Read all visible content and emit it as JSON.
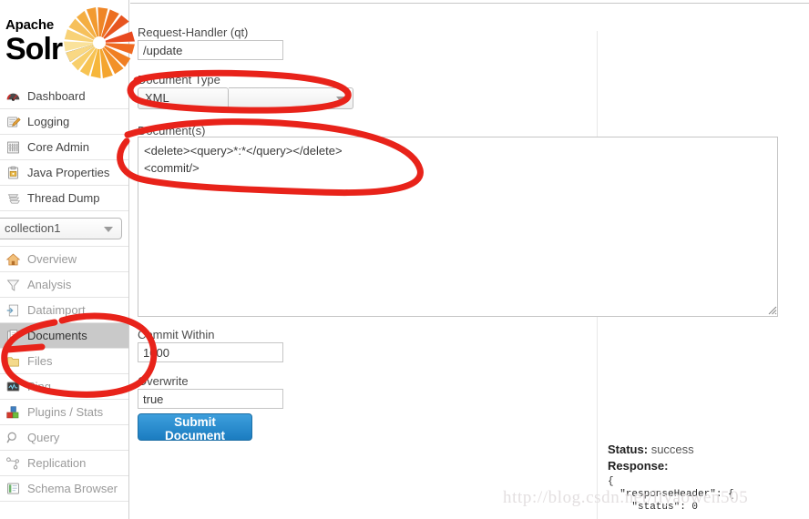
{
  "branding": {
    "apache": "Apache",
    "solr": "Solr",
    "logo_icon": "solr-sunburst-logo",
    "sun_colors": [
      "#f7a823",
      "#ef7e23",
      "#e0491f",
      "#f6d365"
    ]
  },
  "sidebar": {
    "global_items": [
      {
        "label": "Dashboard",
        "icon": "dashboard-gauge-icon",
        "state": "normal"
      },
      {
        "label": "Logging",
        "icon": "logging-icon",
        "state": "normal"
      },
      {
        "label": "Core Admin",
        "icon": "core-admin-icon",
        "state": "normal"
      },
      {
        "label": "Java Properties",
        "icon": "java-properties-icon",
        "state": "normal"
      },
      {
        "label": "Thread Dump",
        "icon": "thread-dump-icon",
        "state": "normal"
      }
    ],
    "core_selector": {
      "value": "collection1",
      "icon": "chevron-down-icon"
    },
    "core_items": [
      {
        "label": "Overview",
        "icon": "home-icon",
        "state": "dim"
      },
      {
        "label": "Analysis",
        "icon": "funnel-icon",
        "state": "dim"
      },
      {
        "label": "Dataimport",
        "icon": "dataimport-icon",
        "state": "dim"
      },
      {
        "label": "Documents",
        "icon": "documents-icon",
        "state": "active"
      },
      {
        "label": "Files",
        "icon": "folder-icon",
        "state": "dim"
      },
      {
        "label": "Ping",
        "icon": "ping-monitor-icon",
        "state": "dim"
      },
      {
        "label": "Plugins / Stats",
        "icon": "plugins-blocks-icon",
        "state": "dim"
      },
      {
        "label": "Query",
        "icon": "magnifier-icon",
        "state": "dim"
      },
      {
        "label": "Replication",
        "icon": "replication-nodes-icon",
        "state": "dim"
      },
      {
        "label": "Schema Browser",
        "icon": "schema-browser-icon",
        "state": "dim"
      }
    ]
  },
  "form": {
    "request_handler": {
      "label": "Request-Handler (qt)",
      "value": "/update"
    },
    "document_type": {
      "label": "Document Type",
      "value": "XML",
      "icon": "chevron-down-icon"
    },
    "documents": {
      "label": "Document(s)",
      "value": "<delete><query>*:*</query></delete>\n<commit/>"
    },
    "commit_within": {
      "label": "Commit Within",
      "value": "1000"
    },
    "overwrite": {
      "label": "Overwrite",
      "value": "true"
    },
    "submit": {
      "label": "Submit Document"
    }
  },
  "result": {
    "status_label": "Status:",
    "status_value": "success",
    "response_label": "Response:",
    "response_body": "{\n  \"responseHeader\": {\n    \"status\": 0"
  },
  "watermark": {
    "text": "http://blog.csdn.net/liyaowen505"
  },
  "annotations": {
    "color": "#e8231a",
    "marks": [
      "ellipse-around-document-type-select",
      "ellipse-around-documents-textarea",
      "ellipse-around-sidebar-documents-item"
    ]
  }
}
